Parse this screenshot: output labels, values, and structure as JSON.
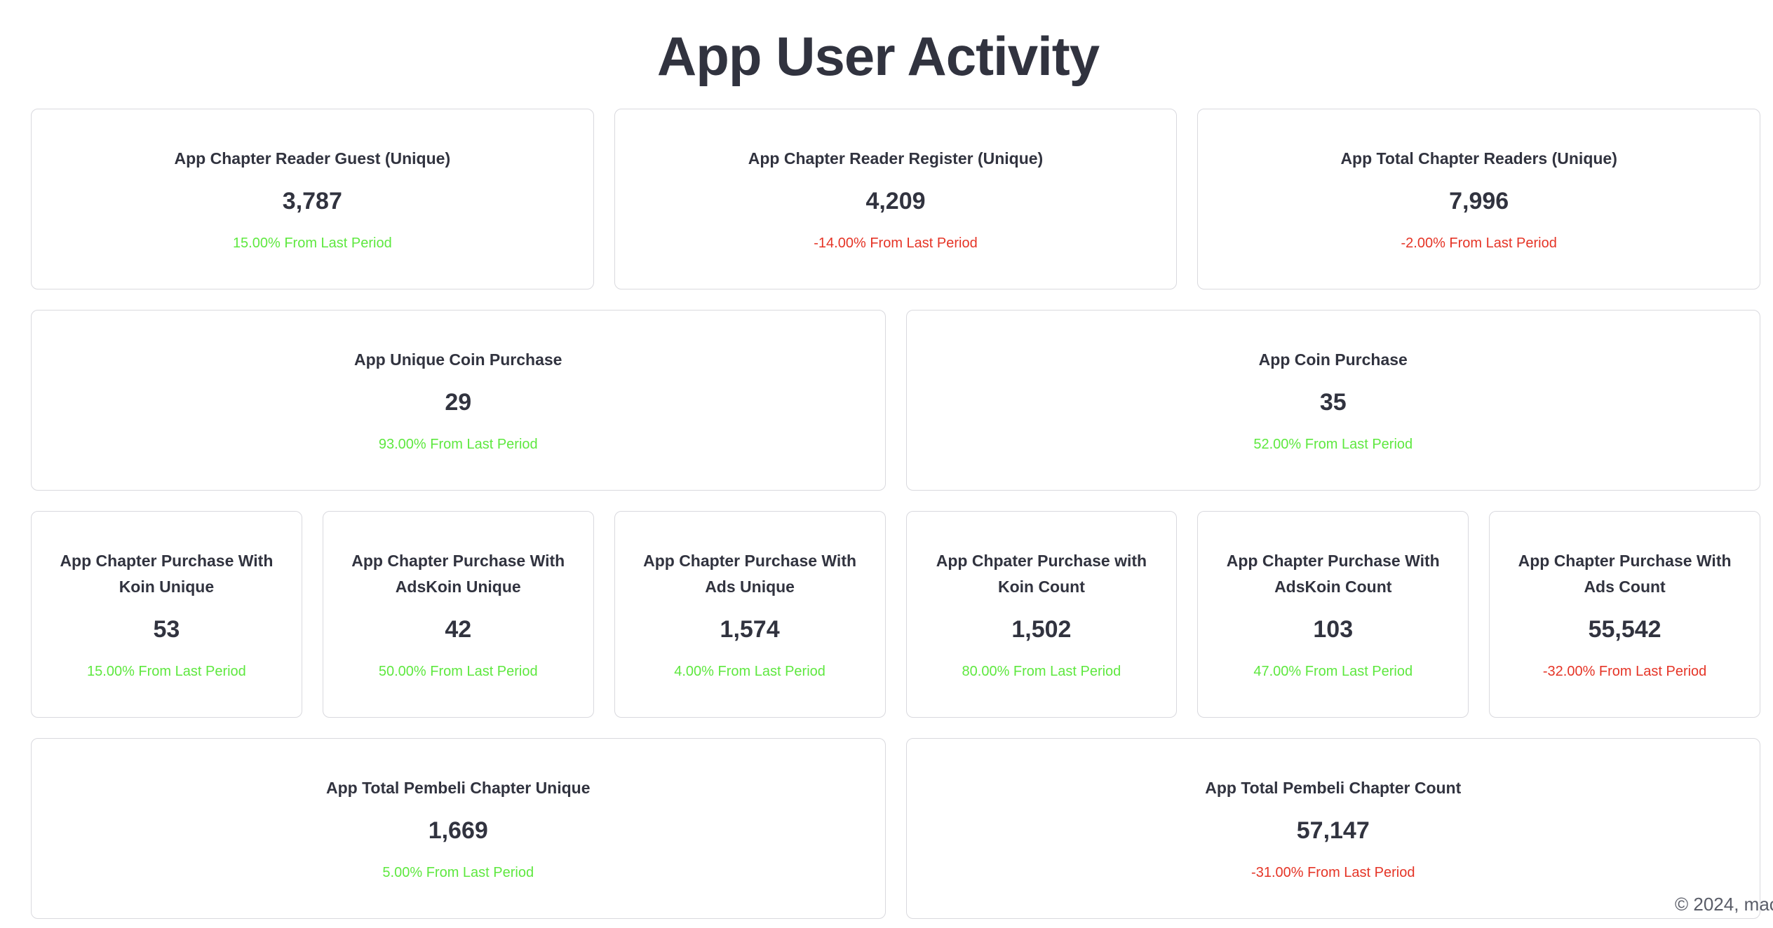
{
  "page": {
    "title": "App User Activity"
  },
  "colors": {
    "positive": "#5ee83f",
    "negative": "#e53426",
    "text": "#31333f",
    "border": "#d9d9de"
  },
  "rows": [
    {
      "cards": [
        {
          "title": "App Chapter Reader Guest (Unique)",
          "value": "3,787",
          "change": "15.00% From Last Period",
          "trend": "positive"
        },
        {
          "title": "App Chapter Reader Register (Unique)",
          "value": "4,209",
          "change": "-14.00% From Last Period",
          "trend": "negative"
        },
        {
          "title": "App Total Chapter Readers (Unique)",
          "value": "7,996",
          "change": "-2.00% From Last Period",
          "trend": "negative"
        }
      ]
    },
    {
      "cards": [
        {
          "title": "App Unique Coin Purchase",
          "value": "29",
          "change": "93.00% From Last Period",
          "trend": "positive"
        },
        {
          "title": "App Coin Purchase",
          "value": "35",
          "change": "52.00% From Last Period",
          "trend": "positive"
        }
      ]
    },
    {
      "cards": [
        {
          "title": "App Chapter Purchase With Koin Unique",
          "value": "53",
          "change": "15.00% From Last Period",
          "trend": "positive"
        },
        {
          "title": "App Chapter Purchase With AdsKoin Unique",
          "value": "42",
          "change": "50.00% From Last Period",
          "trend": "positive"
        },
        {
          "title": "App Chapter Purchase With Ads Unique",
          "value": "1,574",
          "change": "4.00% From Last Period",
          "trend": "positive"
        },
        {
          "title": "App Chpater Purchase with Koin Count",
          "value": "1,502",
          "change": "80.00% From Last Period",
          "trend": "positive"
        },
        {
          "title": "App Chapter Purchase With AdsKoin Count",
          "value": "103",
          "change": "47.00% From Last Period",
          "trend": "positive"
        },
        {
          "title": "App Chapter Purchase With Ads Count",
          "value": "55,542",
          "change": "-32.00% From Last Period",
          "trend": "negative"
        }
      ]
    },
    {
      "cards": [
        {
          "title": "App Total Pembeli Chapter Unique",
          "value": "1,669",
          "change": "5.00% From Last Period",
          "trend": "positive"
        },
        {
          "title": "App Total Pembeli Chapter Count",
          "value": "57,147",
          "change": "-31.00% From Last Period",
          "trend": "negative"
        }
      ]
    }
  ],
  "footer": {
    "text": "© 2024, mac"
  }
}
